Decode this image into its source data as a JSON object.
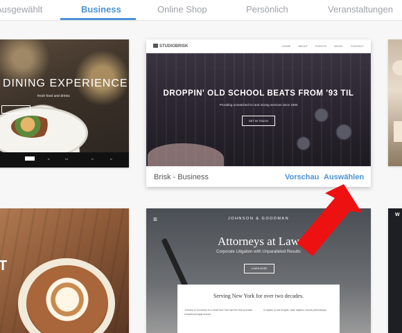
{
  "tabs": {
    "items": [
      {
        "label": "Ausgewählt"
      },
      {
        "label": "Business"
      },
      {
        "label": "Online Shop"
      },
      {
        "label": "Persönlich"
      },
      {
        "label": "Veranstaltungen"
      }
    ],
    "active_index": 1,
    "accent_color": "#4b92d6"
  },
  "cards": {
    "restaurant": {
      "headline": "DINING EXPERIENCE",
      "subline": "fresh food and drinks"
    },
    "brisk": {
      "logo": "STUDIOBRISK",
      "nav": [
        "HOME",
        "ABOUT",
        "EVENTS",
        "MUSIC",
        "CONTACT"
      ],
      "headline": "DROPPIN' OLD SCHOOL BEATS FROM '93 TIL",
      "subline": "Providing unmatched DJ and mixing services since 1993",
      "button": "GET IN TOUCH",
      "name": "Brisk - Business",
      "preview_label": "Vorschau",
      "select_label": "Auswählen"
    },
    "coffee": {
      "glyph": "T"
    },
    "law": {
      "menu_glyph": "≡",
      "logo": "JOHNSON & GOODMAN",
      "headline": "Attorneys at Law",
      "subline": "Corporate Litigation with Unparalleled Results",
      "button": "LEARN MORE",
      "panel_title": "Serving New York for over two decades.",
      "col_left": "Johnson & Goodman is a small New York law firm that provides exceptional legal service",
      "col_right": "In sapien ut nisl fringilla, vitae dapibus mauris pellentesque"
    },
    "right_bottom": {
      "letter": "W"
    }
  },
  "annotation": {
    "arrow_color": "#ee1111",
    "target": "select_button"
  }
}
